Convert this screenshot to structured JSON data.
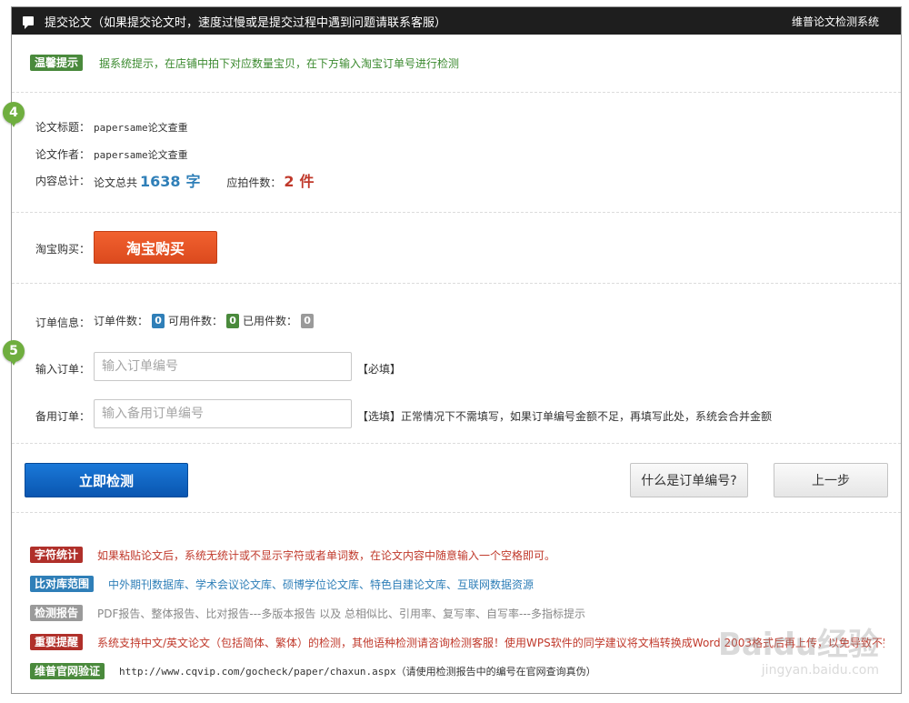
{
  "window": {
    "title": "提交论文（如果提交论文时，速度过慢或是提交过程中遇到问题请联系客服）",
    "system_name": "维普论文检测系统"
  },
  "tip": {
    "tag": "温馨提示",
    "text": "据系统提示，在店铺中拍下对应数量宝贝，在下方输入淘宝订单号进行检测"
  },
  "paper": {
    "step": "4",
    "title_label": "论文标题：",
    "title_value": "papersame论文查重",
    "author_label": "论文作者：",
    "author_value": "papersame论文查重",
    "total_label": "内容总计：",
    "total_prefix": "论文总共",
    "char_count": "1638",
    "char_unit": "字",
    "pieces_label": "应拍件数：",
    "pieces_count": "2",
    "pieces_unit": "件"
  },
  "purchase": {
    "label": "淘宝购买：",
    "button": "淘宝购买"
  },
  "order": {
    "step": "5",
    "info_label": "订单信息：",
    "order_count_label": "订单件数：",
    "order_count": "0",
    "available_label": "可用件数：",
    "available_count": "0",
    "used_label": "已用件数：",
    "used_count": "0",
    "input_label": "输入订单：",
    "input_placeholder": "输入订单编号",
    "input_hint": "【必填】",
    "backup_label": "备用订单：",
    "backup_placeholder": "输入备用订单编号",
    "backup_hint": "【选填】正常情况下不需填写，如果订单编号金额不足，再填写此处，系统会合并金额"
  },
  "actions": {
    "submit": "立即检测",
    "what_is_order": "什么是订单编号?",
    "back": "上一步"
  },
  "notes": [
    {
      "tag": "字符统计",
      "tag_color": "#b0302a",
      "text": "如果粘贴论文后，系统无统计或不显示字符或者单词数，在论文内容中随意输入一个空格即可。",
      "text_color": "#c0392b"
    },
    {
      "tag": "比对库范围",
      "tag_color": "#2f7fb8",
      "text": "中外期刊数据库、学术会议论文库、硕博学位论文库、特色自建论文库、互联网数据资源",
      "text_color": "#2f7fb8"
    },
    {
      "tag": "检测报告",
      "tag_color": "#9a9a9a",
      "text": "PDF报告、整体报告、比对报告---多版本报告 以及 总相似比、引用率、复写率、自写率---多指标提示",
      "text_color": "#888888"
    },
    {
      "tag": "重要提醒",
      "tag_color": "#b0302a",
      "text": "系统支持中文/英文论文（包括简体、繁体）的检测，其他语种检测请咨询检测客服！使用WPS软件的同学建议将文档转换成Word 2003格式后再上传，以免导致不完整》",
      "text_color": "#c0392b"
    },
    {
      "tag": "维普官网验证",
      "tag_color": "#4a8a3c",
      "text": "http://www.cqvip.com/gocheck/paper/chaxun.aspx（请使用检测报告中的编号在官网查询真伪）",
      "text_color": "#333333"
    }
  ],
  "watermark": {
    "main": "Baidu经验",
    "sub": "jingyan.baidu.com"
  }
}
